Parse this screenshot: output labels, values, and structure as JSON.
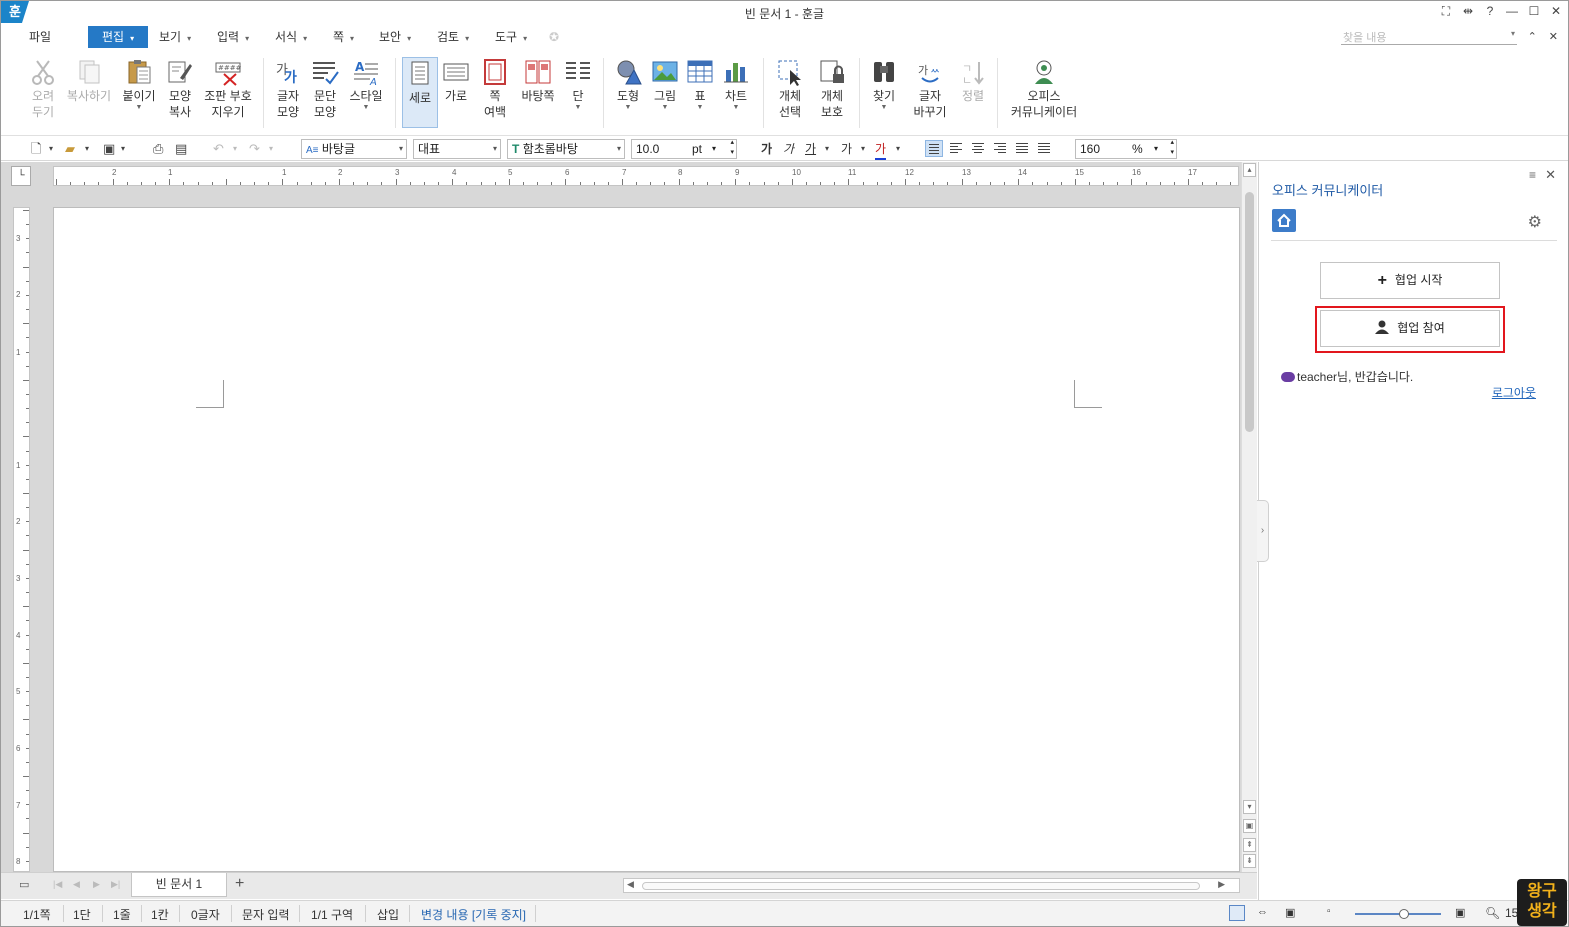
{
  "app": {
    "logo": "훈",
    "title": "빈 문서 1 - 훈글"
  },
  "window_controls": [
    "⛶",
    "⇹",
    "?",
    "—",
    "☐",
    "✕"
  ],
  "menu": {
    "items": [
      "파일",
      "편집",
      "보기",
      "입력",
      "서식",
      "쪽",
      "보안",
      "검토",
      "도구"
    ],
    "active": "편집",
    "find_placeholder": "찾을 내용"
  },
  "ribbon": {
    "buttons": [
      {
        "id": "cut",
        "label": "오려\n두기",
        "icon": "scissors-icon",
        "disabled": true
      },
      {
        "id": "copy",
        "label": "복사하기",
        "icon": "copy-icon",
        "disabled": true
      },
      {
        "id": "paste",
        "label": "붙이기",
        "icon": "clipboard-icon"
      },
      {
        "id": "format-copy",
        "label": "모양\n복사",
        "icon": "brush-icon"
      },
      {
        "id": "clear-marks",
        "label": "조판 부호\n지우기",
        "icon": "clear-marks-icon"
      },
      {
        "id": "char-shape",
        "label": "글자\n모양",
        "icon": "char-shape-icon"
      },
      {
        "id": "para-shape",
        "label": "문단\n모양",
        "icon": "para-shape-icon"
      },
      {
        "id": "style",
        "label": "스타일",
        "icon": "style-icon"
      },
      {
        "id": "portrait",
        "label": "세로",
        "icon": "portrait-page-icon",
        "selected": true
      },
      {
        "id": "landscape",
        "label": "가로",
        "icon": "landscape-page-icon"
      },
      {
        "id": "page-margin",
        "label": "쪽\n여백",
        "icon": "page-margin-icon"
      },
      {
        "id": "master-page",
        "label": "바탕쪽",
        "icon": "master-page-icon"
      },
      {
        "id": "columns",
        "label": "단",
        "icon": "columns-icon"
      },
      {
        "id": "shape",
        "label": "도형",
        "icon": "shape-icon"
      },
      {
        "id": "picture",
        "label": "그림",
        "icon": "picture-icon"
      },
      {
        "id": "table",
        "label": "표",
        "icon": "table-icon"
      },
      {
        "id": "chart",
        "label": "차트",
        "icon": "chart-icon"
      },
      {
        "id": "select-object",
        "label": "개체\n선택",
        "icon": "select-object-icon"
      },
      {
        "id": "protect-object",
        "label": "개체\n보호",
        "icon": "lock-object-icon"
      },
      {
        "id": "find",
        "label": "찾기",
        "icon": "binoculars-icon"
      },
      {
        "id": "replace",
        "label": "글자\n바꾸기",
        "icon": "replace-icon"
      },
      {
        "id": "sort",
        "label": "정렬",
        "icon": "sort-icon",
        "disabled": true
      },
      {
        "id": "communicator",
        "label": "오피스\n커뮤니케이터",
        "icon": "communicator-icon"
      }
    ]
  },
  "format_bar": {
    "style": "바탕글",
    "language": "대표",
    "font": "함초롬바탕",
    "font_size": "10.0",
    "font_unit": "pt",
    "line_spacing": "160",
    "line_unit": "%",
    "char_buttons": [
      "가",
      "가",
      "가",
      "가",
      "가"
    ]
  },
  "ruler": {
    "h_numbers": [
      "2",
      "1",
      "1",
      "1",
      "2",
      "3",
      "4",
      "5",
      "6",
      "7",
      "8",
      "9",
      "10",
      "11",
      "12",
      "13",
      "14",
      "15",
      "16",
      "17"
    ],
    "v_numbers": [
      "3",
      "2",
      "1",
      "1",
      "2",
      "3",
      "4",
      "5",
      "6",
      "7",
      "8"
    ]
  },
  "tabs": {
    "document": "빈 문서 1",
    "add": "+"
  },
  "status": {
    "page": "1/1쪽",
    "column": "1단",
    "line": "1줄",
    "cell": "1칸",
    "chars": "0글자",
    "input_mode": "문자 입력",
    "section": "1/1 구역",
    "insert": "삽입",
    "track": "변경 내용 [기록 중지]",
    "zoom_partial": "15"
  },
  "panel": {
    "title": "오피스 커뮤니케이터",
    "start_label": "협업 시작",
    "join_label": "협업 참여",
    "welcome": "teacher님, 반갑습니다.",
    "logout": "로그아웃"
  },
  "watermark": {
    "line1": "왕구",
    "line2": "생각"
  }
}
